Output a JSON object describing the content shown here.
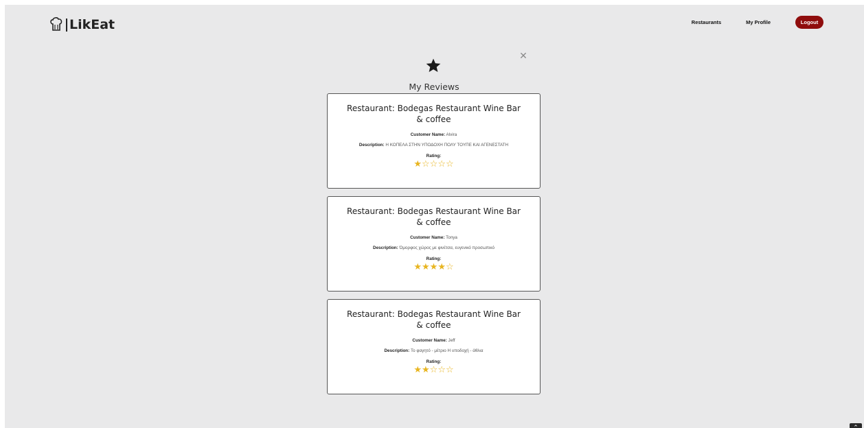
{
  "brand": {
    "name": "LikEat",
    "icon": "chef-hat-icon"
  },
  "nav": {
    "restaurants_label": "Restaurants",
    "profile_label": "My Profile",
    "logout_label": "Logout"
  },
  "modal": {
    "title": "My Reviews",
    "header_icon": "star-icon",
    "close_icon": "close-icon"
  },
  "labels": {
    "restaurant_prefix": "Restaurant:",
    "customer_name": "Customer Name:",
    "description": "Description:",
    "rating": "Rating:"
  },
  "reviews": [
    {
      "restaurant": "Bodegas Restaurant Wine Bar & coffee",
      "customer_name": "Alvira",
      "description": "Η ΚΟΠΕΛΑ ΣΤΗΝ ΥΠΟΔΟΧΗ ΠΟΛΥ ΤΟΥΠΕ ΚΑΙ ΑΓΕΝΕΣΤΑΤΗ",
      "rating": 1,
      "max_rating": 5
    },
    {
      "restaurant": "Bodegas Restaurant Wine Bar & coffee",
      "customer_name": "Tonya",
      "description": "Όμορφος χώρος με φινέτσα, ευγενικό προσωπικό",
      "rating": 4,
      "max_rating": 5
    },
    {
      "restaurant": "Bodegas Restaurant Wine Bar & coffee",
      "customer_name": "Jeff",
      "description": "Το φαγητό - μέτριο Η υποδοχή - άθλια",
      "rating": 2,
      "max_rating": 5
    }
  ],
  "colors": {
    "background": "#e9e9ea",
    "logout_bg": "#8f0d0d",
    "star": "#e8b520",
    "card_border": "#555555"
  },
  "scroll_top_icon": "chevron-up-icon"
}
